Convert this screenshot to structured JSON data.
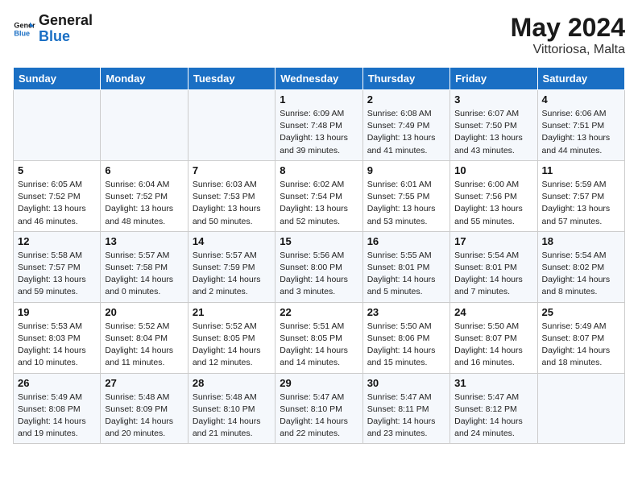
{
  "header": {
    "logo_general": "General",
    "logo_blue": "Blue",
    "month_year": "May 2024",
    "location": "Vittoriosa, Malta"
  },
  "weekdays": [
    "Sunday",
    "Monday",
    "Tuesday",
    "Wednesday",
    "Thursday",
    "Friday",
    "Saturday"
  ],
  "weeks": [
    [
      {
        "day": "",
        "info": ""
      },
      {
        "day": "",
        "info": ""
      },
      {
        "day": "",
        "info": ""
      },
      {
        "day": "1",
        "info": "Sunrise: 6:09 AM\nSunset: 7:48 PM\nDaylight: 13 hours\nand 39 minutes."
      },
      {
        "day": "2",
        "info": "Sunrise: 6:08 AM\nSunset: 7:49 PM\nDaylight: 13 hours\nand 41 minutes."
      },
      {
        "day": "3",
        "info": "Sunrise: 6:07 AM\nSunset: 7:50 PM\nDaylight: 13 hours\nand 43 minutes."
      },
      {
        "day": "4",
        "info": "Sunrise: 6:06 AM\nSunset: 7:51 PM\nDaylight: 13 hours\nand 44 minutes."
      }
    ],
    [
      {
        "day": "5",
        "info": "Sunrise: 6:05 AM\nSunset: 7:52 PM\nDaylight: 13 hours\nand 46 minutes."
      },
      {
        "day": "6",
        "info": "Sunrise: 6:04 AM\nSunset: 7:52 PM\nDaylight: 13 hours\nand 48 minutes."
      },
      {
        "day": "7",
        "info": "Sunrise: 6:03 AM\nSunset: 7:53 PM\nDaylight: 13 hours\nand 50 minutes."
      },
      {
        "day": "8",
        "info": "Sunrise: 6:02 AM\nSunset: 7:54 PM\nDaylight: 13 hours\nand 52 minutes."
      },
      {
        "day": "9",
        "info": "Sunrise: 6:01 AM\nSunset: 7:55 PM\nDaylight: 13 hours\nand 53 minutes."
      },
      {
        "day": "10",
        "info": "Sunrise: 6:00 AM\nSunset: 7:56 PM\nDaylight: 13 hours\nand 55 minutes."
      },
      {
        "day": "11",
        "info": "Sunrise: 5:59 AM\nSunset: 7:57 PM\nDaylight: 13 hours\nand 57 minutes."
      }
    ],
    [
      {
        "day": "12",
        "info": "Sunrise: 5:58 AM\nSunset: 7:57 PM\nDaylight: 13 hours\nand 59 minutes."
      },
      {
        "day": "13",
        "info": "Sunrise: 5:57 AM\nSunset: 7:58 PM\nDaylight: 14 hours\nand 0 minutes."
      },
      {
        "day": "14",
        "info": "Sunrise: 5:57 AM\nSunset: 7:59 PM\nDaylight: 14 hours\nand 2 minutes."
      },
      {
        "day": "15",
        "info": "Sunrise: 5:56 AM\nSunset: 8:00 PM\nDaylight: 14 hours\nand 3 minutes."
      },
      {
        "day": "16",
        "info": "Sunrise: 5:55 AM\nSunset: 8:01 PM\nDaylight: 14 hours\nand 5 minutes."
      },
      {
        "day": "17",
        "info": "Sunrise: 5:54 AM\nSunset: 8:01 PM\nDaylight: 14 hours\nand 7 minutes."
      },
      {
        "day": "18",
        "info": "Sunrise: 5:54 AM\nSunset: 8:02 PM\nDaylight: 14 hours\nand 8 minutes."
      }
    ],
    [
      {
        "day": "19",
        "info": "Sunrise: 5:53 AM\nSunset: 8:03 PM\nDaylight: 14 hours\nand 10 minutes."
      },
      {
        "day": "20",
        "info": "Sunrise: 5:52 AM\nSunset: 8:04 PM\nDaylight: 14 hours\nand 11 minutes."
      },
      {
        "day": "21",
        "info": "Sunrise: 5:52 AM\nSunset: 8:05 PM\nDaylight: 14 hours\nand 12 minutes."
      },
      {
        "day": "22",
        "info": "Sunrise: 5:51 AM\nSunset: 8:05 PM\nDaylight: 14 hours\nand 14 minutes."
      },
      {
        "day": "23",
        "info": "Sunrise: 5:50 AM\nSunset: 8:06 PM\nDaylight: 14 hours\nand 15 minutes."
      },
      {
        "day": "24",
        "info": "Sunrise: 5:50 AM\nSunset: 8:07 PM\nDaylight: 14 hours\nand 16 minutes."
      },
      {
        "day": "25",
        "info": "Sunrise: 5:49 AM\nSunset: 8:07 PM\nDaylight: 14 hours\nand 18 minutes."
      }
    ],
    [
      {
        "day": "26",
        "info": "Sunrise: 5:49 AM\nSunset: 8:08 PM\nDaylight: 14 hours\nand 19 minutes."
      },
      {
        "day": "27",
        "info": "Sunrise: 5:48 AM\nSunset: 8:09 PM\nDaylight: 14 hours\nand 20 minutes."
      },
      {
        "day": "28",
        "info": "Sunrise: 5:48 AM\nSunset: 8:10 PM\nDaylight: 14 hours\nand 21 minutes."
      },
      {
        "day": "29",
        "info": "Sunrise: 5:47 AM\nSunset: 8:10 PM\nDaylight: 14 hours\nand 22 minutes."
      },
      {
        "day": "30",
        "info": "Sunrise: 5:47 AM\nSunset: 8:11 PM\nDaylight: 14 hours\nand 23 minutes."
      },
      {
        "day": "31",
        "info": "Sunrise: 5:47 AM\nSunset: 8:12 PM\nDaylight: 14 hours\nand 24 minutes."
      },
      {
        "day": "",
        "info": ""
      }
    ]
  ]
}
